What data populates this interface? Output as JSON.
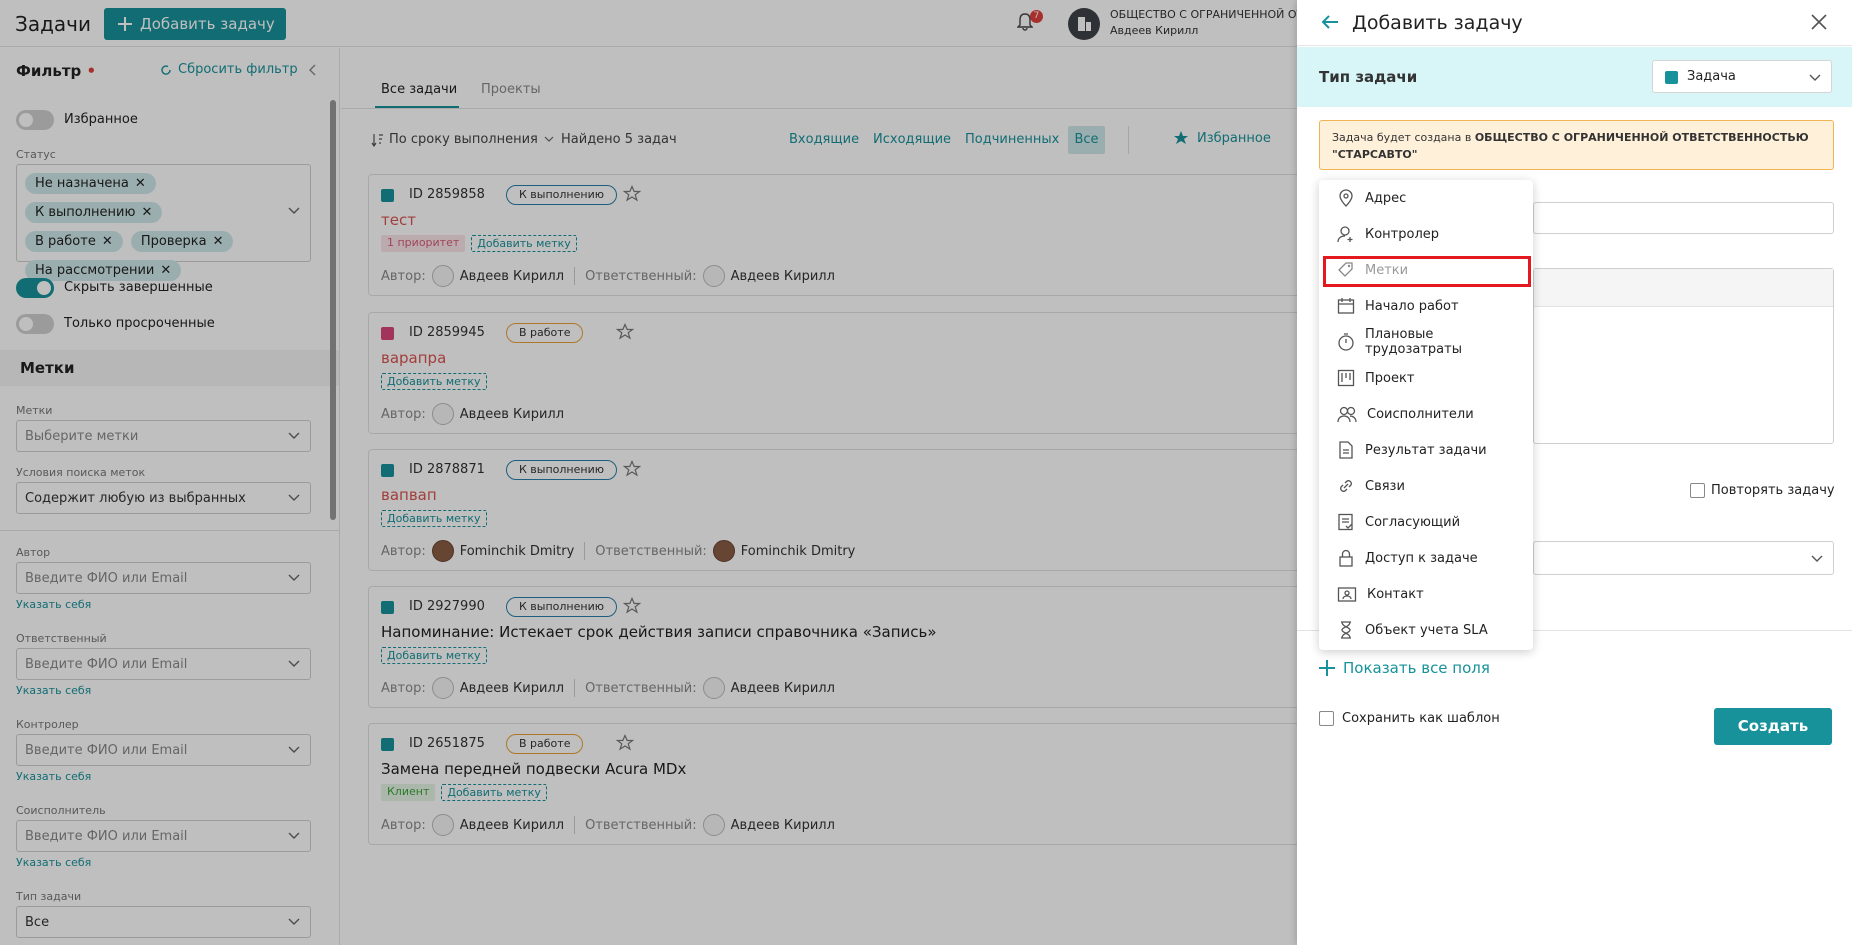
{
  "header": {
    "title": "Задачи",
    "add_task_label": "Добавить задачу",
    "notification_count": "7",
    "org_name": "ОБЩЕСТВО С ОГРАНИЧЕННОЙ ОТВЕ",
    "user_name": "Авдеев Кирилл"
  },
  "sidebar": {
    "filter_title": "Фильтр",
    "reset_filter": "Сбросить фильтр",
    "favorites_label": "Избранное",
    "status_label": "Статус",
    "status_chips": [
      "Не назначена",
      "К выполнению",
      "В работе",
      "Проверка",
      "На рассмотрении"
    ],
    "hide_done_label": "Скрыть завершенные",
    "overdue_label": "Только просроченные",
    "tags_section": "Метки",
    "tags_label": "Метки",
    "tags_placeholder": "Выберите метки",
    "tag_search_label": "Условия поиска меток",
    "tag_search_value": "Содержит любую из выбранных",
    "author_label": "Автор",
    "person_placeholder": "Введите ФИО или Email",
    "self_link": "Указать себя",
    "responsible_label": "Ответственный",
    "controller_label": "Контролер",
    "coexecutor_label": "Соисполнитель",
    "task_type_label": "Тип задачи",
    "task_type_value": "Все"
  },
  "main": {
    "tabs": [
      "Все задачи",
      "Проекты"
    ],
    "sort_label": "По сроку выполнения",
    "found_label": "Найдено 5 задач",
    "filters": [
      "Входящие",
      "Исходящие",
      "Подчиненных",
      "Все"
    ],
    "favorites_label": "Избранное",
    "author_prefix": "Автор:",
    "responsible_prefix": "Ответственный:",
    "add_tag_label": "Добавить метку",
    "tasks": [
      {
        "id": "ID 2859858",
        "status": "К выполнению",
        "title": "тест",
        "tag": "1 приоритет",
        "author": "Авдеев Кирилл",
        "responsible": "Авдеев Кирилл"
      },
      {
        "id": "ID 2859945",
        "status": "В работе",
        "title": "варапра",
        "tag": "",
        "author": "Авдеев Кирилл",
        "responsible": ""
      },
      {
        "id": "ID 2878871",
        "status": "К выполнению",
        "title": "вапвап",
        "tag": "",
        "author": "Fominchik Dmitry",
        "responsible": "Fominchik Dmitry"
      },
      {
        "id": "ID 2927990",
        "status": "К выполнению",
        "title": "Напоминание: Истекает срок действия записи справочника «Запись»",
        "tag": "",
        "author": "Авдеев Кирилл",
        "responsible": "Авдеев Кирилл"
      },
      {
        "id": "ID 2651875",
        "status": "В работе",
        "title": "Замена передней подвески Acura MDx",
        "tag": "Клиент",
        "author": "Авдеев Кирилл",
        "responsible": "Авдеев Кирилл"
      }
    ]
  },
  "panel": {
    "title": "Добавить задачу",
    "type_label": "Тип задачи",
    "type_value": "Задача",
    "notice_prefix": "Задача будет создана в ",
    "notice_org": "ОБЩЕСТВО С ОГРАНИЧЕННОЙ ОТВЕТСТВЕННОСТЬЮ \"СТАРСАВТО\"",
    "dropdown_items": [
      "Адрес",
      "Контролер",
      "Метки",
      "Начало работ",
      "Плановые трудозатраты",
      "Проект",
      "Соисполнители",
      "Результат задачи",
      "Связи",
      "Согласующий",
      "Доступ к задаче",
      "Контакт",
      "Объект учета SLA"
    ],
    "repeat_label": "Повторять задачу",
    "show_all_label": "Показать все поля",
    "save_template_label": "Сохранить как шаблон",
    "create_label": "Создать"
  },
  "colors": {
    "accent": "#17929a",
    "highlight": "#e3191f",
    "notice_bg": "#fff0da"
  }
}
